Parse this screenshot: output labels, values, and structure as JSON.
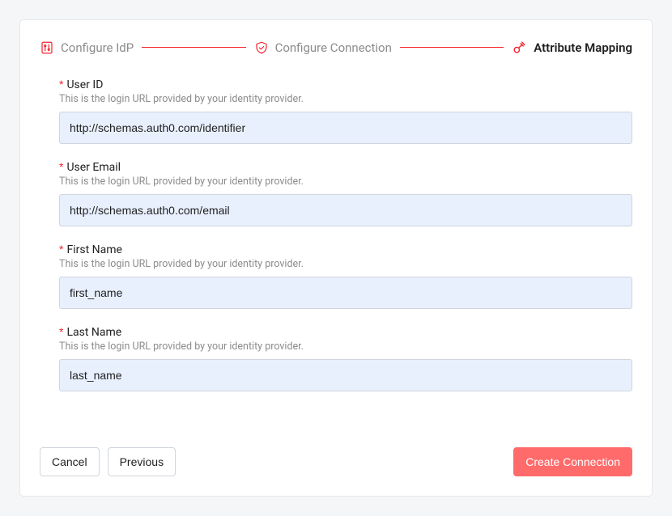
{
  "stepper": {
    "steps": [
      {
        "label": "Configure IdP"
      },
      {
        "label": "Configure Connection"
      },
      {
        "label": "Attribute Mapping"
      }
    ]
  },
  "form": {
    "user_id": {
      "label": "User ID",
      "hint": "This is the login URL provided by your identity provider.",
      "value": "http://schemas.auth0.com/identifier"
    },
    "user_email": {
      "label": "User Email",
      "hint": "This is the login URL provided by your identity provider.",
      "value": "http://schemas.auth0.com/email"
    },
    "first_name": {
      "label": "First Name",
      "hint": "This is the login URL provided by your identity provider.",
      "value": "first_name"
    },
    "last_name": {
      "label": "Last Name",
      "hint": "This is the login URL provided by your identity provider.",
      "value": "last_name"
    }
  },
  "footer": {
    "cancel": "Cancel",
    "previous": "Previous",
    "submit": "Create Connection"
  }
}
